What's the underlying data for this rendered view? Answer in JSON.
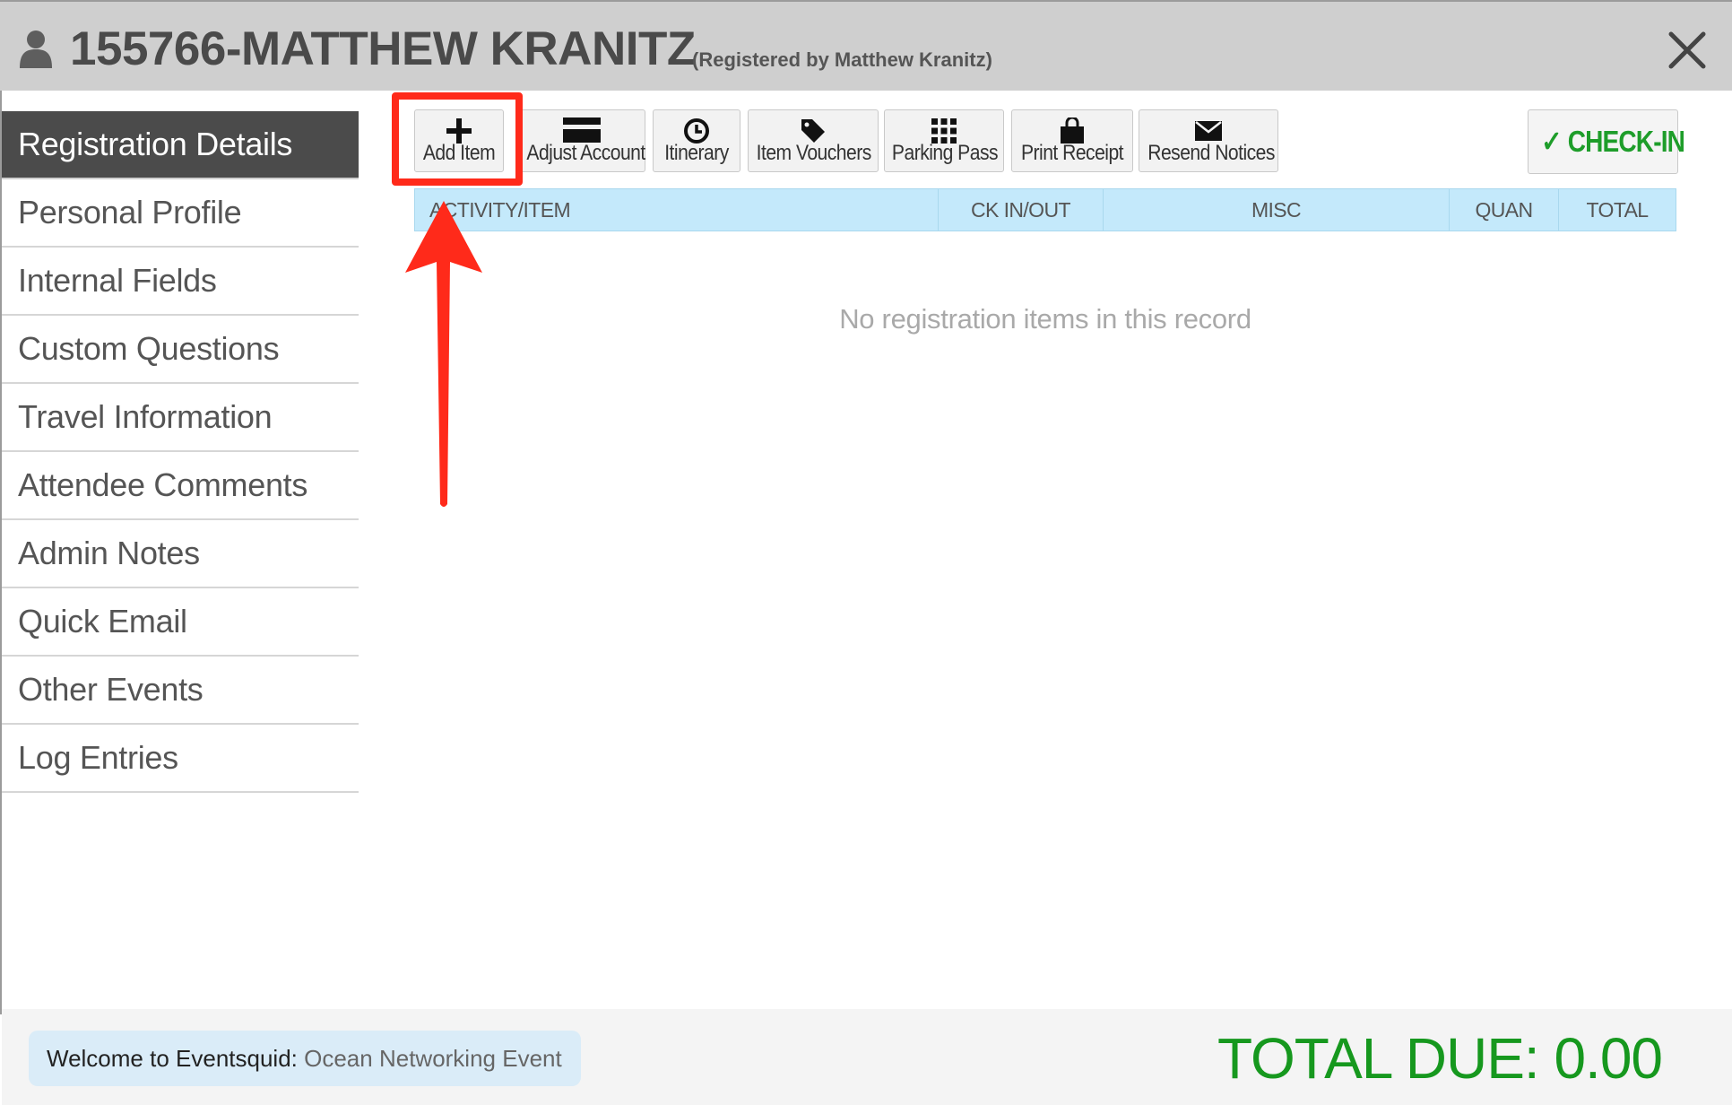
{
  "header": {
    "title": "155766-MATTHEW KRANITZ",
    "subtitle": "(Registered by Matthew Kranitz)",
    "icons": {
      "user": "user-icon",
      "close": "close-icon"
    }
  },
  "sidebar": {
    "items": [
      {
        "label": "Registration Details",
        "active": true
      },
      {
        "label": "Personal Profile"
      },
      {
        "label": "Internal Fields"
      },
      {
        "label": "Custom Questions"
      },
      {
        "label": "Travel Information"
      },
      {
        "label": "Attendee Comments"
      },
      {
        "label": "Admin Notes"
      },
      {
        "label": "Quick Email"
      },
      {
        "label": "Other Events"
      },
      {
        "label": "Log Entries"
      }
    ]
  },
  "toolbar": {
    "buttons": [
      {
        "label": "Add Item",
        "icon": "plus-icon"
      },
      {
        "label": "Adjust Account",
        "icon": "credit-card-icon"
      },
      {
        "label": "Itinerary",
        "icon": "clock-icon"
      },
      {
        "label": "Item Vouchers",
        "icon": "tag-icon"
      },
      {
        "label": "Parking Pass",
        "icon": "grid-icon"
      },
      {
        "label": "Print Receipt",
        "icon": "shopping-bag-icon"
      },
      {
        "label": "Resend Notices",
        "icon": "envelope-icon"
      }
    ],
    "checkin": "CHECK-IN"
  },
  "table": {
    "columns": [
      "ACTIVITY/ITEM",
      "CK IN/OUT",
      "MISC",
      "QUAN",
      "TOTAL"
    ],
    "empty_message": "No registration items in this record"
  },
  "footer": {
    "welcome_label": "Welcome to Eventsquid:",
    "event_name": "Ocean Networking Event",
    "total_due": "TOTAL DUE: 0.00"
  },
  "colors": {
    "header_bg": "#cfcfcf",
    "nav_active_bg": "#4b4b4b",
    "table_header_bg": "#c4e9fb",
    "accent_green": "#16981e",
    "highlight_red": "#ff2a1a"
  }
}
